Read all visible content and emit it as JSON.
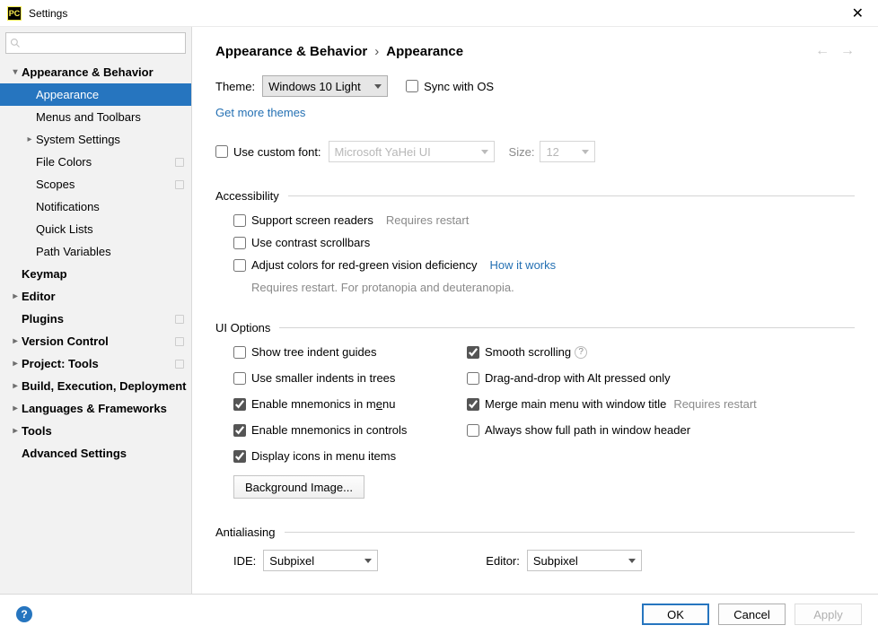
{
  "window": {
    "title": "Settings"
  },
  "search": {
    "placeholder": ""
  },
  "sidebar": {
    "items": [
      {
        "label": "Appearance & Behavior",
        "level": 0,
        "expanded": true
      },
      {
        "label": "Appearance",
        "level": 1,
        "selected": true
      },
      {
        "label": "Menus and Toolbars",
        "level": 1
      },
      {
        "label": "System Settings",
        "level": 1,
        "hasChildren": true
      },
      {
        "label": "File Colors",
        "level": 1,
        "badge": true
      },
      {
        "label": "Scopes",
        "level": 1,
        "badge": true
      },
      {
        "label": "Notifications",
        "level": 1
      },
      {
        "label": "Quick Lists",
        "level": 1
      },
      {
        "label": "Path Variables",
        "level": 1
      },
      {
        "label": "Keymap",
        "level": 0,
        "noarrow": true
      },
      {
        "label": "Editor",
        "level": 0
      },
      {
        "label": "Plugins",
        "level": 0,
        "noarrow": true,
        "badge": true
      },
      {
        "label": "Version Control",
        "level": 0,
        "badge": true
      },
      {
        "label": "Project: Tools",
        "level": 0,
        "badge": true
      },
      {
        "label": "Build, Execution, Deployment",
        "level": 0
      },
      {
        "label": "Languages & Frameworks",
        "level": 0
      },
      {
        "label": "Tools",
        "level": 0
      },
      {
        "label": "Advanced Settings",
        "level": 0,
        "noarrow": true
      }
    ]
  },
  "breadcrumb": {
    "a": "Appearance & Behavior",
    "b": "Appearance"
  },
  "theme": {
    "label": "Theme:",
    "value": "Windows 10 Light",
    "sync": "Sync with OS",
    "more": "Get more themes"
  },
  "font": {
    "useCustom": "Use custom font:",
    "family": "Microsoft YaHei UI",
    "sizeLabel": "Size:",
    "sizeValue": "12"
  },
  "a11y": {
    "title": "Accessibility",
    "screenReaders": "Support screen readers",
    "restart": "Requires restart",
    "contrast": "Use contrast scrollbars",
    "colorblind": "Adjust colors for red-green vision deficiency",
    "how": "How it works",
    "sub": "Requires restart. For protanopia and deuteranopia."
  },
  "ui": {
    "title": "UI Options",
    "treeGuides": "Show tree indent guides",
    "smallerIndents": "Use smaller indents in trees",
    "mnemonicsMenu": "Enable mnemonics in menu",
    "mnemonicsCtrl": "Enable mnemonics in controls",
    "displayIcons": "Display icons in menu items",
    "smoothScroll": "Smooth scrolling",
    "dnd": "Drag-and-drop with Alt pressed only",
    "mergeMenu": "Merge main menu with window title",
    "restart": "Requires restart",
    "fullPath": "Always show full path in window header",
    "bgBtn": "Background Image..."
  },
  "aa": {
    "title": "Antialiasing",
    "ideLabel": "IDE:",
    "ideValue": "Subpixel",
    "editorLabel": "Editor:",
    "editorValue": "Subpixel"
  },
  "footer": {
    "ok": "OK",
    "cancel": "Cancel",
    "apply": "Apply"
  }
}
